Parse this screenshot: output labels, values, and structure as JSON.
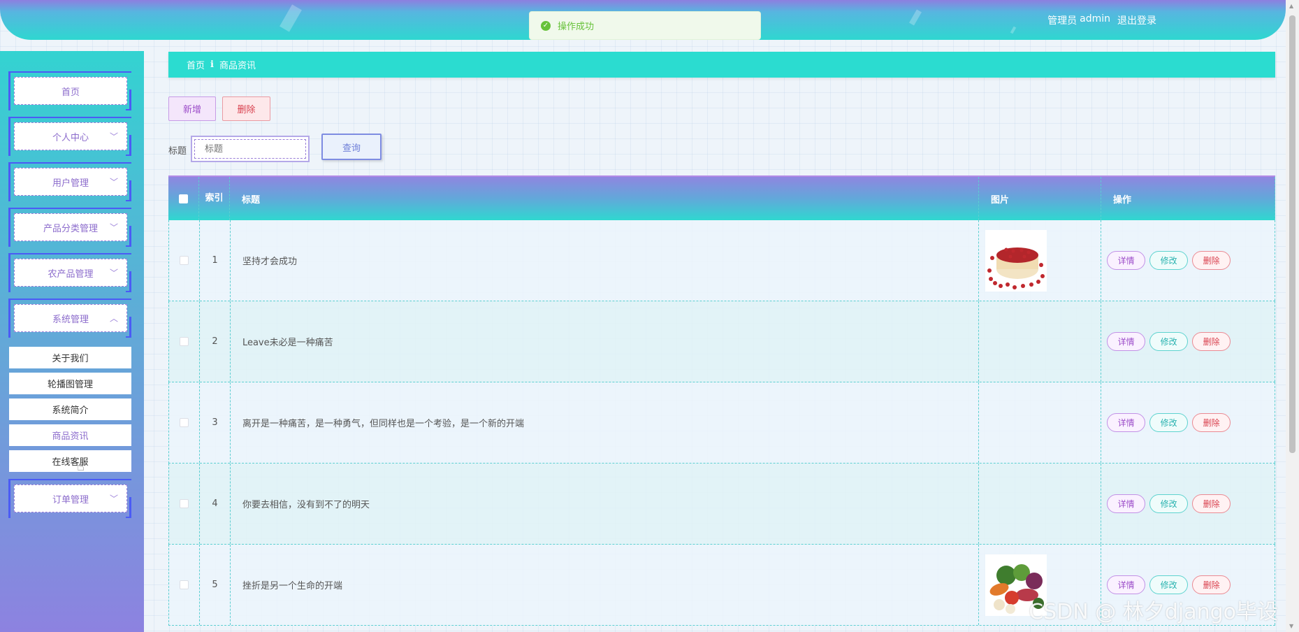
{
  "header": {
    "role_label": "管理员",
    "username": "admin",
    "logout": "退出登录"
  },
  "toast": {
    "message": "操作成功",
    "color": "#67c23a"
  },
  "sidebar": {
    "menu": [
      {
        "label": "首页",
        "has_chevron": false
      },
      {
        "label": "个人中心",
        "has_chevron": true,
        "chevron": "down"
      },
      {
        "label": "用户管理",
        "has_chevron": true,
        "chevron": "down"
      },
      {
        "label": "产品分类管理",
        "has_chevron": true,
        "chevron": "down"
      },
      {
        "label": "农产品管理",
        "has_chevron": true,
        "chevron": "down"
      },
      {
        "label": "系统管理",
        "has_chevron": true,
        "chevron": "up"
      },
      {
        "label": "订单管理",
        "has_chevron": true,
        "chevron": "down"
      }
    ],
    "submenu": [
      {
        "label": "关于我们"
      },
      {
        "label": "轮播图管理"
      },
      {
        "label": "系统简介"
      },
      {
        "label": "商品资讯",
        "active": true
      },
      {
        "label": "在线客服"
      }
    ]
  },
  "breadcrumb": {
    "home": "首页",
    "separator": "ℹ",
    "current": "商品资讯"
  },
  "toolbar": {
    "add": "新增",
    "delete": "删除"
  },
  "search": {
    "label": "标题",
    "placeholder": "标题",
    "button": "查询"
  },
  "table": {
    "headers": {
      "index": "索引",
      "title": "标题",
      "image": "图片",
      "actions": "操作"
    },
    "actions": {
      "detail": "详情",
      "edit": "修改",
      "delete": "删除"
    },
    "rows": [
      {
        "index": "1",
        "title": "坚持才会成功",
        "image": "red-beans"
      },
      {
        "index": "2",
        "title": "Leave未必是一种痛苦",
        "image": ""
      },
      {
        "index": "3",
        "title": "离开是一种痛苦，是一种勇气，但同样也是一个考验，是一个新的开端",
        "image": ""
      },
      {
        "index": "4",
        "title": "你要去相信，没有到不了的明天",
        "image": ""
      },
      {
        "index": "5",
        "title": "挫折是另一个生命的开端",
        "image": "vegetables"
      }
    ]
  },
  "watermark": "CSDN @ 林夕django毕设",
  "colors": {
    "accent_teal": "#2bdcd0",
    "accent_purple": "#8c6ccc",
    "danger": "#d9424f"
  }
}
